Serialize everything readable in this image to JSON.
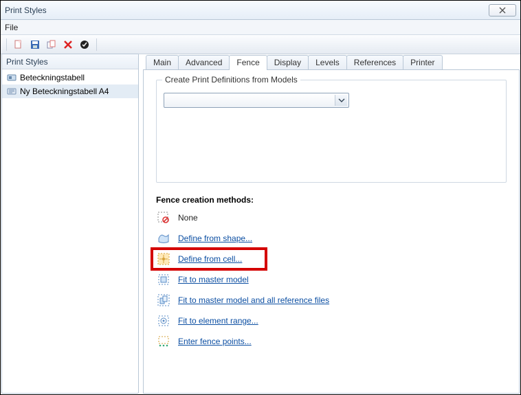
{
  "window": {
    "title": "Print Styles",
    "close_label": "✕"
  },
  "menu": {
    "file": "File"
  },
  "toolbar": {
    "icons": [
      "new-doc-icon",
      "save-icon",
      "copy-style-icon",
      "delete-icon",
      "apply-icon"
    ]
  },
  "left_panel": {
    "header": "Print Styles",
    "items": [
      {
        "label": "Beteckningstabell",
        "selected": false
      },
      {
        "label": "Ny Beteckningstabell A4",
        "selected": true
      }
    ]
  },
  "tabs": [
    {
      "label": "Main",
      "active": false
    },
    {
      "label": "Advanced",
      "active": false
    },
    {
      "label": "Fence",
      "active": true
    },
    {
      "label": "Display",
      "active": false
    },
    {
      "label": "Levels",
      "active": false
    },
    {
      "label": "References",
      "active": false
    },
    {
      "label": "Printer",
      "active": false
    }
  ],
  "fence_tab": {
    "group_title": "Create Print Definitions from Models",
    "combo_value": "",
    "section_title": "Fence creation methods:",
    "methods": [
      {
        "label": "None",
        "link": false,
        "highlight": false,
        "icon": "none-icon"
      },
      {
        "label": "Define from shape...",
        "link": true,
        "highlight": false,
        "icon": "shape-icon"
      },
      {
        "label": "Define from cell...",
        "link": true,
        "highlight": true,
        "icon": "cell-icon"
      },
      {
        "label": "Fit to master model",
        "link": true,
        "highlight": false,
        "icon": "fit-master-icon"
      },
      {
        "label": "Fit to master model and all reference files",
        "link": true,
        "highlight": false,
        "icon": "fit-all-icon"
      },
      {
        "label": "Fit to element range...",
        "link": true,
        "highlight": false,
        "icon": "range-icon"
      },
      {
        "label": "Enter fence points...",
        "link": true,
        "highlight": false,
        "icon": "points-icon"
      }
    ]
  }
}
